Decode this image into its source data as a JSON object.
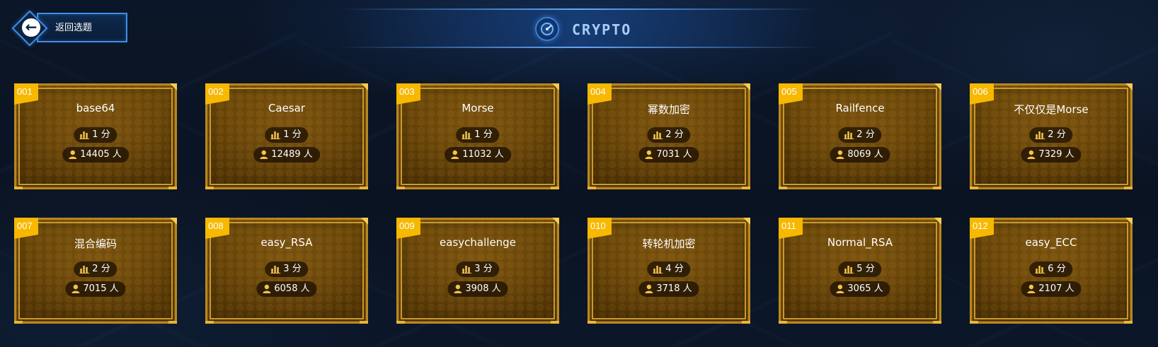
{
  "header": {
    "back_label": "返回选题",
    "title": "CRYPTO",
    "back_icon": "left-arrow-icon",
    "title_icon": "gauge-icon"
  },
  "colors": {
    "accent_blue": "#3d8ee8",
    "card_tag": "#f7b800",
    "card_bg": "#5b3b06",
    "card_border": "#c99a2e"
  },
  "challenges": [
    {
      "id": "001",
      "name": "base64",
      "score": "1 分",
      "solvers": "14405 人"
    },
    {
      "id": "002",
      "name": "Caesar",
      "score": "1 分",
      "solvers": "12489 人"
    },
    {
      "id": "003",
      "name": "Morse",
      "score": "1 分",
      "solvers": "11032 人"
    },
    {
      "id": "004",
      "name": "幂数加密",
      "score": "2 分",
      "solvers": "7031 人"
    },
    {
      "id": "005",
      "name": "Railfence",
      "score": "2 分",
      "solvers": "8069 人"
    },
    {
      "id": "006",
      "name": "不仅仅是Morse",
      "score": "2 分",
      "solvers": "7329 人"
    },
    {
      "id": "007",
      "name": "混合编码",
      "score": "2 分",
      "solvers": "7015 人"
    },
    {
      "id": "008",
      "name": "easy_RSA",
      "score": "3 分",
      "solvers": "6058 人"
    },
    {
      "id": "009",
      "name": "easychallenge",
      "score": "3 分",
      "solvers": "3908 人"
    },
    {
      "id": "010",
      "name": "转轮机加密",
      "score": "4 分",
      "solvers": "3718 人"
    },
    {
      "id": "011",
      "name": "Normal_RSA",
      "score": "5 分",
      "solvers": "3065 人"
    },
    {
      "id": "012",
      "name": "easy_ECC",
      "score": "6 分",
      "solvers": "2107 人"
    }
  ]
}
